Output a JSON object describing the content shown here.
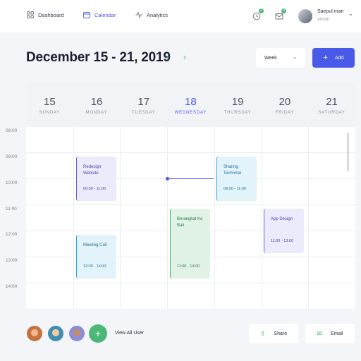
{
  "nav": {
    "dashboard": "Dashboard",
    "calendar": "Calendar",
    "analytics": "Analytics"
  },
  "notifications": {
    "bell_count": "2",
    "mail_count": "4"
  },
  "user": {
    "name": "Saepul man",
    "role": "Admin"
  },
  "header": {
    "date_range": "December 15 - 21, 2019",
    "view_select": "Week",
    "add_label": "Add"
  },
  "days": [
    {
      "num": "15",
      "name": "SUNDAY"
    },
    {
      "num": "16",
      "name": "MONDAY"
    },
    {
      "num": "17",
      "name": "TUESDAY"
    },
    {
      "num": "18",
      "name": "WEDNESDAY"
    },
    {
      "num": "19",
      "name": "THURSDAY"
    },
    {
      "num": "20",
      "name": "FRIDAY"
    },
    {
      "num": "21",
      "name": "SATURDAY"
    }
  ],
  "hours": [
    "08:00",
    "09:00",
    "10:00",
    "11:00",
    "12:00",
    "13:00",
    "14:00"
  ],
  "events": [
    {
      "title": "Redesign Website",
      "time": "09:00 - 11:00"
    },
    {
      "title": "Meeting Call",
      "time": "12:00 - 14:00"
    },
    {
      "title": "Sharing Technical",
      "time": "09:00 - 11:00"
    },
    {
      "title": "Berangkat Ke Bali",
      "time": "11:00 - 14:00"
    },
    {
      "title": "App Design",
      "time": "11:00 - 13:00"
    }
  ],
  "footer": {
    "view_all": "View All User",
    "share": "Share",
    "email": "Email"
  },
  "colors": {
    "accent": "#4a5ae8",
    "green": "#4cb878",
    "purple": "#6b5fd6",
    "blue": "#2ea3d6"
  }
}
